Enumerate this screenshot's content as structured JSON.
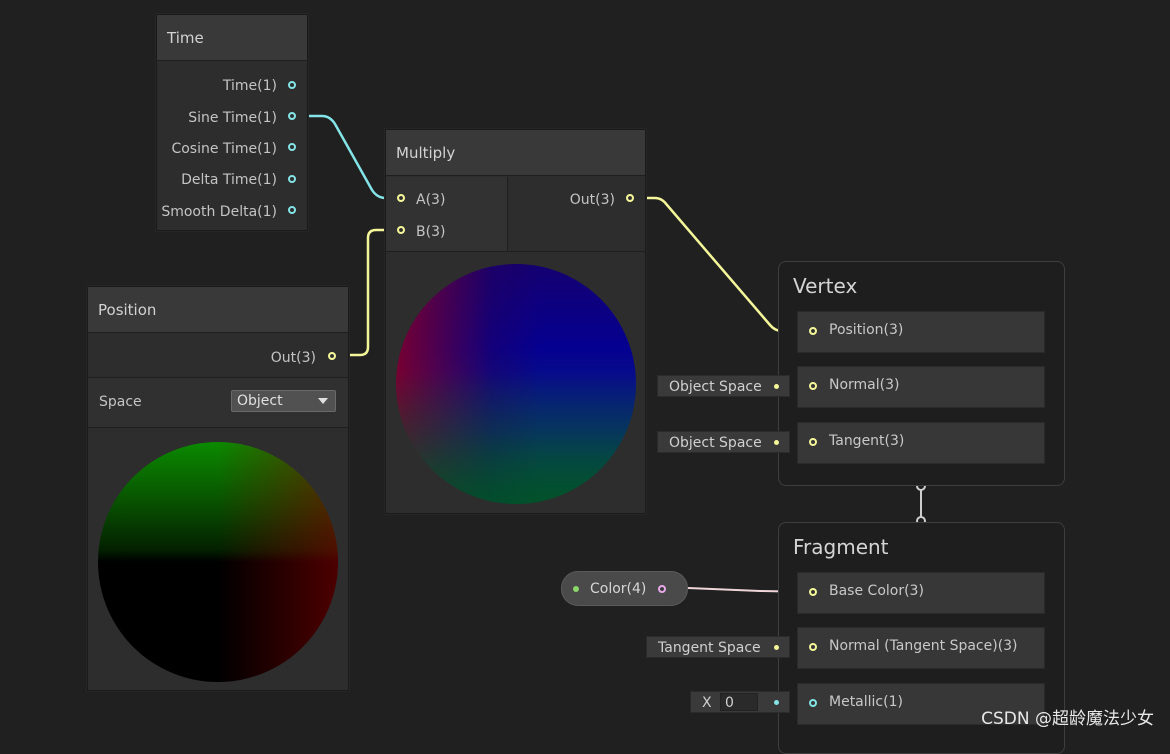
{
  "nodes": {
    "time": {
      "title": "Time",
      "outputs": [
        "Time(1)",
        "Sine Time(1)",
        "Cosine Time(1)",
        "Delta Time(1)",
        "Smooth Delta(1)"
      ]
    },
    "position": {
      "title": "Position",
      "output": "Out(3)",
      "space_label": "Space",
      "space_value": "Object"
    },
    "multiply": {
      "title": "Multiply",
      "inputs": [
        "A(3)",
        "B(3)"
      ],
      "output": "Out(3)"
    },
    "color_property": {
      "label": "Color(4)"
    }
  },
  "master_stack": {
    "vertex": {
      "title": "Vertex",
      "blocks": [
        "Position(3)",
        "Normal(3)",
        "Tangent(3)"
      ],
      "normal_default": "Object Space",
      "tangent_default": "Object Space"
    },
    "fragment": {
      "title": "Fragment",
      "blocks": [
        "Base Color(3)",
        "Normal (Tangent Space)(3)",
        "Metallic(1)"
      ],
      "normal_default": "Tangent Space",
      "metallic_axis": "X",
      "metallic_value": "0"
    }
  },
  "watermark": "CSDN @超龄魔法少女",
  "colors": {
    "background": "#202020",
    "float_port": "#84e4e7",
    "vector3_port": "#f4f699",
    "vector4_port": "#e6a8e8",
    "node_body": "#2d2d2d",
    "node_title": "#393939"
  }
}
